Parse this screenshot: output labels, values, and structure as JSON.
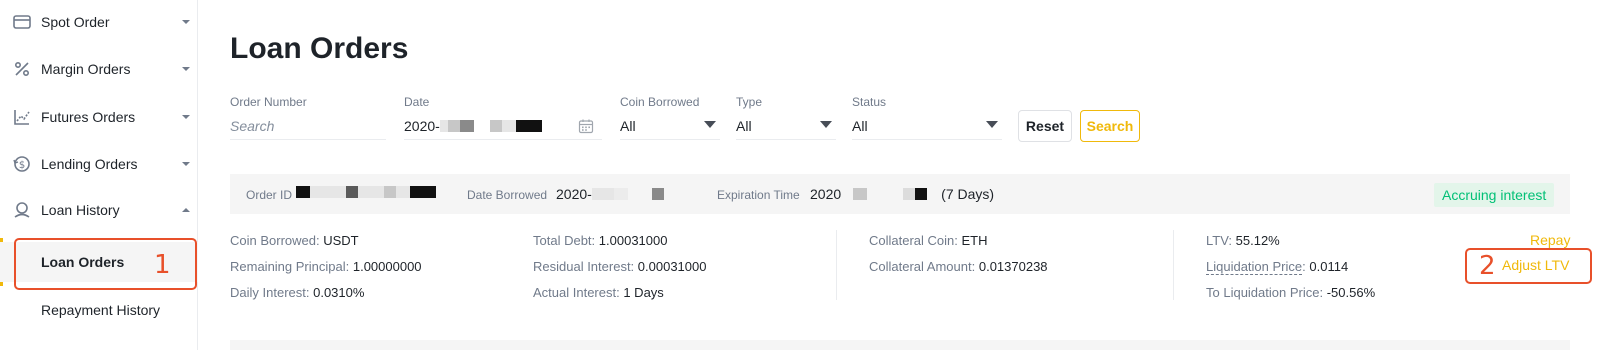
{
  "sidebar": {
    "items": [
      {
        "label": "Spot Order",
        "icon": "wallet-icon",
        "expanded": false
      },
      {
        "label": "Margin Orders",
        "icon": "percent-icon",
        "expanded": false
      },
      {
        "label": "Futures Orders",
        "icon": "futures-icon",
        "expanded": false
      },
      {
        "label": "Lending Orders",
        "icon": "lending-icon",
        "expanded": false
      },
      {
        "label": "Loan History",
        "icon": "loan-icon",
        "expanded": true
      }
    ],
    "subitems": [
      {
        "label": "Loan Orders",
        "active": true
      },
      {
        "label": "Repayment History",
        "active": false
      }
    ]
  },
  "annotations": {
    "one": "1",
    "two": "2",
    "color": "#e8502a"
  },
  "page": {
    "title": "Loan Orders"
  },
  "filters": {
    "order_number": {
      "label": "Order Number",
      "placeholder": "Search"
    },
    "date": {
      "label": "Date",
      "value_prefix": "2020-"
    },
    "coin_borrowed": {
      "label": "Coin Borrowed",
      "value": "All"
    },
    "type": {
      "label": "Type",
      "value": "All"
    },
    "status": {
      "label": "Status",
      "value": "All"
    },
    "reset_label": "Reset",
    "search_label": "Search"
  },
  "order": {
    "order_id_label": "Order ID",
    "date_borrowed_label": "Date Borrowed",
    "date_borrowed_prefix": "2020-",
    "expiration_label": "Expiration Time",
    "expiration_prefix": "2020",
    "expiration_days": "(7 Days)",
    "status": "Accruing interest",
    "details": {
      "coin_borrowed": {
        "label": "Coin Borrowed:",
        "value": "USDT"
      },
      "remaining_principal": {
        "label": "Remaining Principal:",
        "value": "1.00000000"
      },
      "daily_interest": {
        "label": "Daily Interest:",
        "value": "0.0310%"
      },
      "total_debt": {
        "label": "Total Debt:",
        "value": "1.00031000"
      },
      "residual_interest": {
        "label": "Residual Interest:",
        "value": "0.00031000"
      },
      "actual_interest": {
        "label": "Actual Interest:",
        "value": "1 Days"
      },
      "collateral_coin": {
        "label": "Collateral Coin:",
        "value": "ETH"
      },
      "collateral_amount": {
        "label": "Collateral Amount:",
        "value": "0.01370238"
      },
      "ltv": {
        "label": "LTV:",
        "value": "55.12%"
      },
      "liquidation_price": {
        "label": "Liquidation Price",
        "value": "0.0114"
      },
      "to_liquidation_price": {
        "label": "To Liquidation Price:",
        "value": "-50.56%"
      }
    },
    "actions": {
      "repay": "Repay",
      "adjust_ltv": "Adjust LTV"
    }
  },
  "colors": {
    "accent": "#f0b90b",
    "status_green": "#02c076",
    "annotation": "#e8502a"
  }
}
